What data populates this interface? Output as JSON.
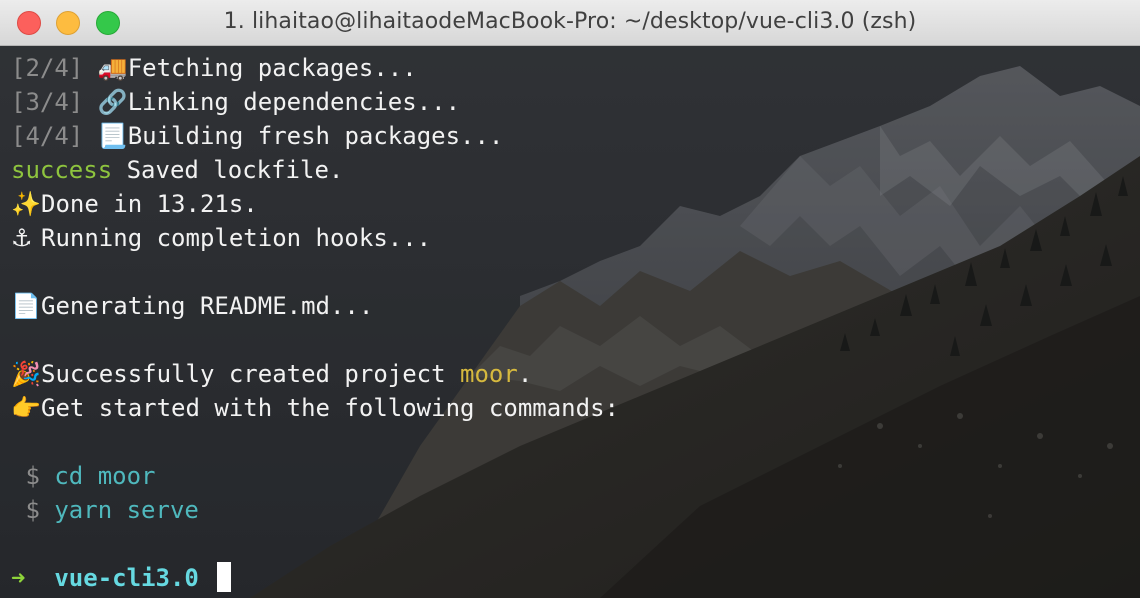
{
  "window": {
    "title": "1. lihaitao@lihaitaodeMacBook-Pro: ~/desktop/vue-cli3.0 (zsh)"
  },
  "terminal": {
    "steps": [
      {
        "counter": "[2/4]",
        "icon": "🚚",
        "icon_name": "truck-icon",
        "text": "Fetching packages..."
      },
      {
        "counter": "[3/4]",
        "icon": "🔗",
        "icon_name": "link-icon",
        "text": "Linking dependencies..."
      },
      {
        "counter": "[4/4]",
        "icon": "📃",
        "icon_name": "page-icon",
        "text": "Building fresh packages..."
      }
    ],
    "success": {
      "label": "success",
      "text": "Saved lockfile."
    },
    "done": {
      "icon": "✨",
      "icon_name": "sparkles-icon",
      "text": "Done in 13.21s."
    },
    "hooks": {
      "icon": "⚓",
      "icon_name": "anchor-icon",
      "text": "Running completion hooks..."
    },
    "readme": {
      "icon": "📄",
      "icon_name": "document-icon",
      "text": "Generating README.md..."
    },
    "created": {
      "icon": "🎉",
      "icon_name": "party-popper-icon",
      "prefix": "Successfully created project ",
      "project": "moor",
      "suffix": "."
    },
    "started": {
      "icon": "👉",
      "icon_name": "pointing-hand-icon",
      "text": "Get started with the following commands:"
    },
    "commands": [
      {
        "symbol": "$",
        "text": "cd moor"
      },
      {
        "symbol": "$",
        "text": "yarn serve"
      }
    ],
    "prompt": {
      "arrow": "➜",
      "directory": "vue-cli3.0"
    }
  },
  "colors": {
    "success_green": "#8ec43e",
    "project_yellow": "#d6b93e",
    "command_cyan": "#4fb8bd",
    "prompt_green": "#8ed43a",
    "prompt_cyan": "#66d9e1"
  }
}
